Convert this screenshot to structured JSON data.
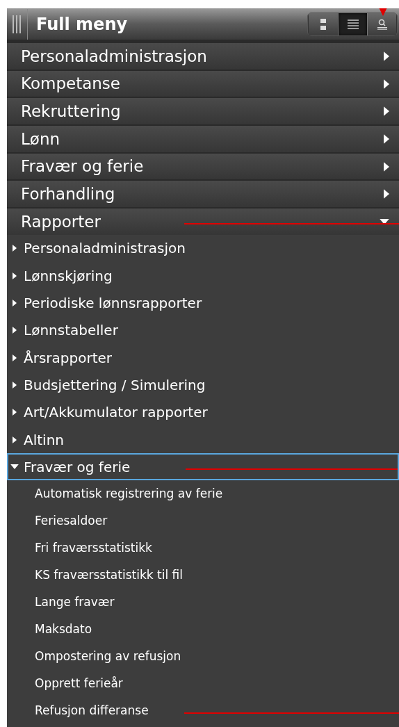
{
  "panel": {
    "title": "Full meny",
    "view_buttons": [
      {
        "kind": "tiles",
        "selected": false,
        "marked": false
      },
      {
        "kind": "list",
        "selected": true,
        "marked": false
      },
      {
        "kind": "search",
        "selected": false,
        "marked": true
      }
    ]
  },
  "menu": [
    {
      "label": "Personaladministrasjon",
      "expanded": false,
      "marked": false
    },
    {
      "label": "Kompetanse",
      "expanded": false,
      "marked": false
    },
    {
      "label": "Rekruttering",
      "expanded": false,
      "marked": false
    },
    {
      "label": "Lønn",
      "expanded": false,
      "marked": false
    },
    {
      "label": "Fravær og ferie",
      "expanded": false,
      "marked": false
    },
    {
      "label": "Forhandling",
      "expanded": false,
      "marked": false
    },
    {
      "label": "Rapporter",
      "expanded": true,
      "marked": true,
      "children": [
        {
          "label": "Personaladministrasjon",
          "expanded": false,
          "selected": false,
          "marked": false
        },
        {
          "label": "Lønnskjøring",
          "expanded": false,
          "selected": false,
          "marked": false
        },
        {
          "label": "Periodiske lønnsrapporter",
          "expanded": false,
          "selected": false,
          "marked": false
        },
        {
          "label": "Lønnstabeller",
          "expanded": false,
          "selected": false,
          "marked": false
        },
        {
          "label": "Årsrapporter",
          "expanded": false,
          "selected": false,
          "marked": false
        },
        {
          "label": "Budsjettering / Simulering",
          "expanded": false,
          "selected": false,
          "marked": false
        },
        {
          "label": "Art/Akkumulator rapporter",
          "expanded": false,
          "selected": false,
          "marked": false
        },
        {
          "label": "Altinn",
          "expanded": false,
          "selected": false,
          "marked": false
        },
        {
          "label": "Fravær og ferie",
          "expanded": true,
          "selected": true,
          "marked": true,
          "children": [
            {
              "label": "Automatisk registrering av ferie",
              "marked": false
            },
            {
              "label": "Feriesaldoer",
              "marked": false
            },
            {
              "label": "Fri fraværsstatistikk",
              "marked": false
            },
            {
              "label": "KS fraværsstatistikk til fil",
              "marked": false
            },
            {
              "label": "Lange fravær",
              "marked": false
            },
            {
              "label": "Maksdato",
              "marked": false
            },
            {
              "label": "Ompostering av refusjon",
              "marked": false
            },
            {
              "label": "Opprett ferieår",
              "marked": false
            },
            {
              "label": "Refusjon differanse",
              "marked": true
            }
          ]
        }
      ]
    }
  ]
}
